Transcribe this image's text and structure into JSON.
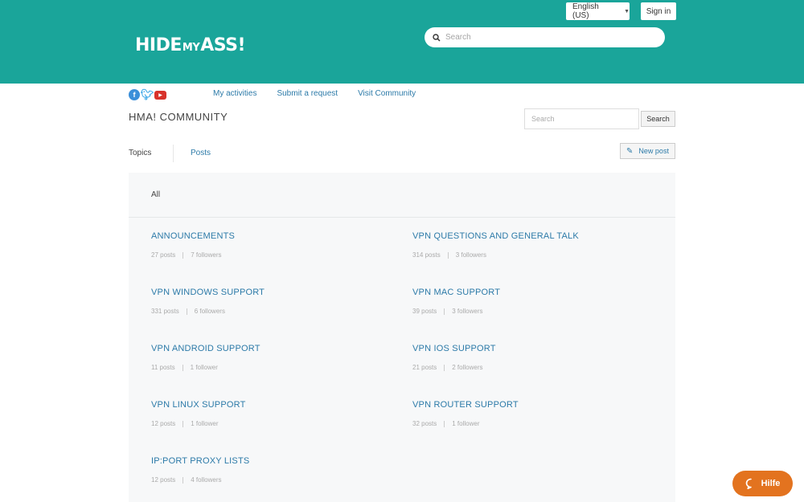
{
  "header": {
    "language": "English (US)",
    "signin": "Sign in",
    "logo": {
      "part1": "HIDE",
      "part2": "MY",
      "part3": "ASS!"
    },
    "search_placeholder": "Search",
    "bg_color": "#1aa59a"
  },
  "nav": {
    "social_icons": [
      "facebook-icon",
      "twitter-icon",
      "youtube-icon"
    ],
    "links": [
      "My activities",
      "Submit a request",
      "Visit Community"
    ]
  },
  "community": {
    "title": "HMA! COMMUNITY",
    "search_placeholder": "Search",
    "search_button": "Search",
    "tabs": [
      "Topics",
      "Posts"
    ],
    "new_post": "New post"
  },
  "topics": {
    "filter": "All",
    "items": [
      {
        "name": "ANNOUNCEMENTS",
        "posts": "27 posts",
        "followers": "7 followers"
      },
      {
        "name": "VPN QUESTIONS AND GENERAL TALK",
        "posts": "314 posts",
        "followers": "3 followers"
      },
      {
        "name": "VPN WINDOWS SUPPORT",
        "posts": "331 posts",
        "followers": "6 followers"
      },
      {
        "name": "VPN MAC SUPPORT",
        "posts": "39 posts",
        "followers": "3 followers"
      },
      {
        "name": "VPN ANDROID SUPPORT",
        "posts": "11 posts",
        "followers": "1 follower"
      },
      {
        "name": "VPN IOS SUPPORT",
        "posts": "21 posts",
        "followers": "2 followers"
      },
      {
        "name": "VPN LINUX SUPPORT",
        "posts": "12 posts",
        "followers": "1 follower"
      },
      {
        "name": "VPN ROUTER SUPPORT",
        "posts": "32 posts",
        "followers": "1 follower"
      },
      {
        "name": "IP:PORT PROXY LISTS",
        "posts": "12 posts",
        "followers": "4 followers"
      }
    ]
  },
  "help": {
    "label": "Hilfe",
    "accent": "#e3731f"
  }
}
